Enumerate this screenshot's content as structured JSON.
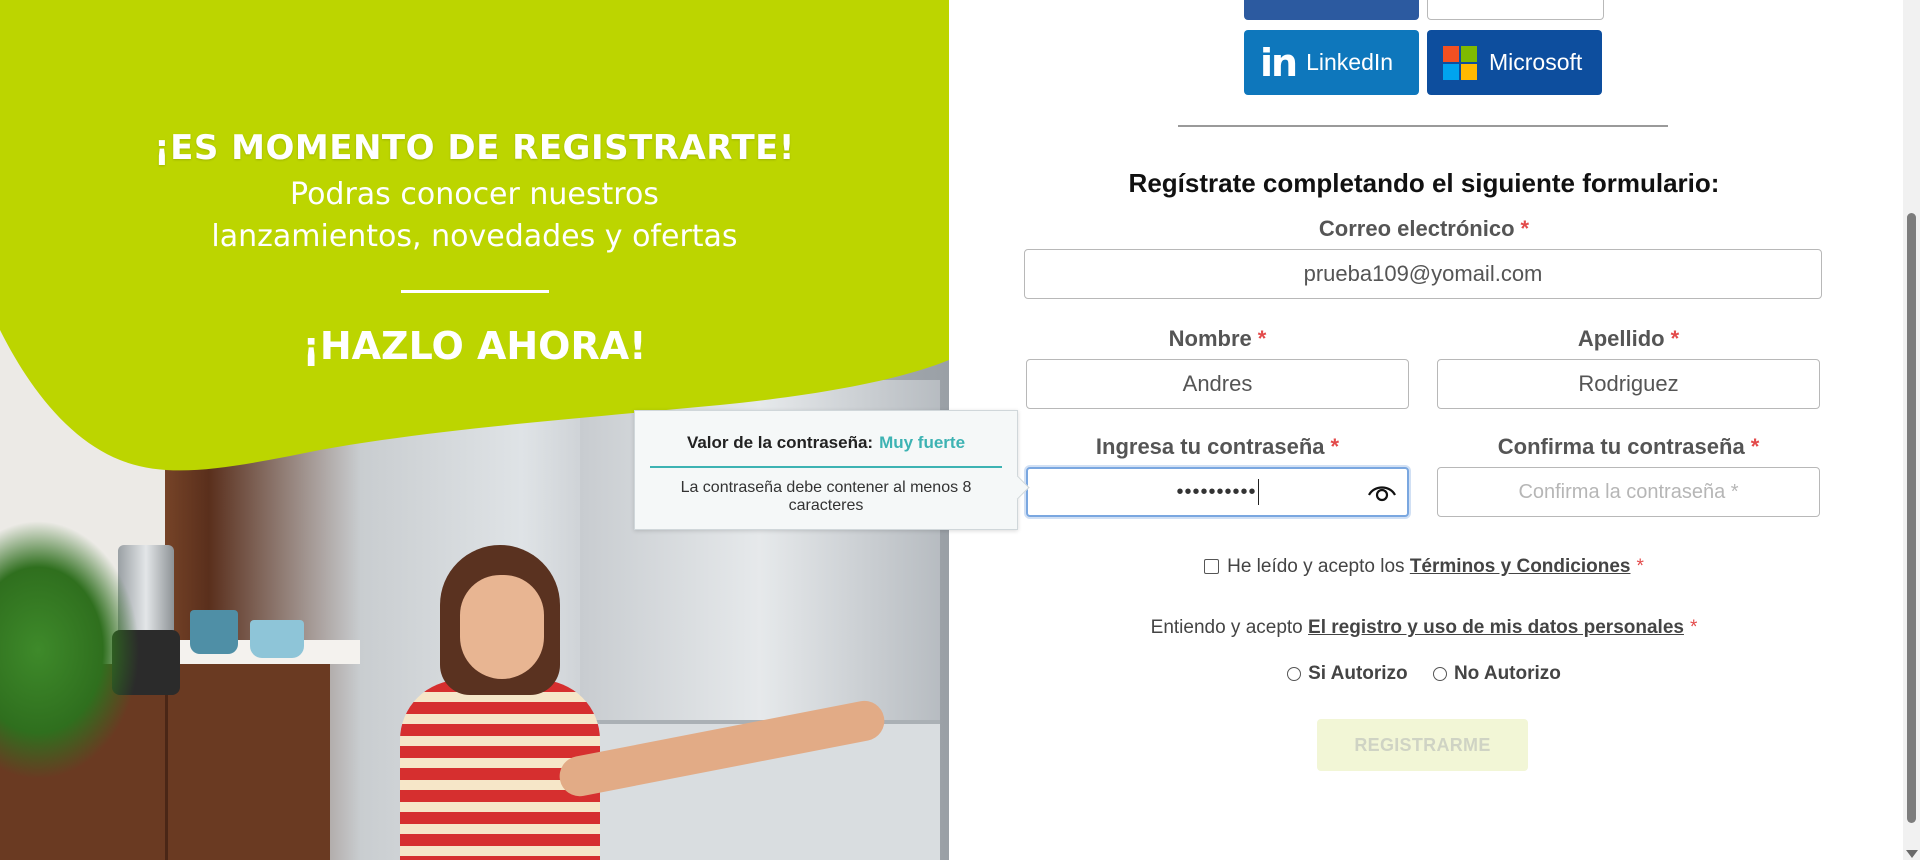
{
  "hero": {
    "headline": "¡ES MOMENTO DE REGISTRARTE!",
    "sub_line1": "Podras conocer nuestros",
    "sub_line2": "lanzamientos, novedades y ofertas",
    "cta": "¡HAZLO AHORA!",
    "brand_green": "#bcd500"
  },
  "tooltip": {
    "strength_label": "Valor de la contraseña:",
    "strength_value": "Muy fuerte",
    "hint": "La contraseña debe contener al menos 8 caracteres",
    "accent": "#3db3b3"
  },
  "social": {
    "linkedin_label": "LinkedIn",
    "linkedin_logo": "in",
    "microsoft_label": "Microsoft"
  },
  "form": {
    "title": "Regístrate completando el siguiente formulario:",
    "required_mark": "*",
    "email": {
      "label": "Correo electrónico",
      "value": "prueba109@yomail.com"
    },
    "first_name": {
      "label": "Nombre",
      "value": "Andres"
    },
    "last_name": {
      "label": "Apellido",
      "value": "Rodriguez"
    },
    "password": {
      "label": "Ingresa tu contraseña",
      "value": "••••••••••"
    },
    "confirm": {
      "label": "Confirma tu contraseña",
      "placeholder": "Confirma la contraseña *"
    },
    "terms_prefix": "He leído y acepto los",
    "terms_link": "Términos y Condiciones",
    "data_prefix": "Entiendo y acepto",
    "data_link": "El registro y uso de mis datos personales",
    "radio_yes": "Si Autorizo",
    "radio_no": "No Autorizo",
    "submit": "REGISTRARME"
  }
}
